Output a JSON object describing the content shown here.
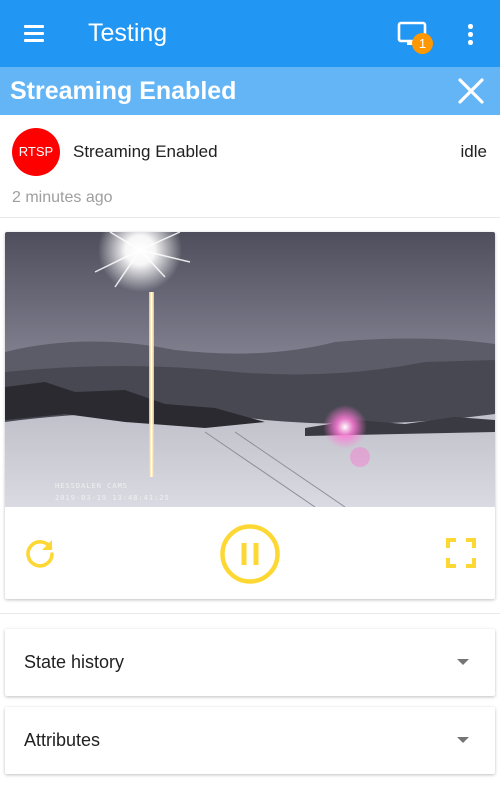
{
  "appbar": {
    "title": "Testing",
    "notification_count": "1",
    "colors": {
      "background": "#2196f3",
      "badge": "#ff9800"
    },
    "icons": {
      "menu": "menu-icon",
      "cast": "cast-icon",
      "more": "more-vert-icon"
    }
  },
  "dialog": {
    "title": "Streaming Enabled",
    "close_icon": "close-icon",
    "header_color": "#64b5f6"
  },
  "entity": {
    "badge": "RTSP",
    "badge_color": "#ff0000",
    "name": "Streaming Enabled",
    "state": "idle",
    "last_changed": "2 minutes ago"
  },
  "camera": {
    "overlay_name": "HESSDALEN CAMS",
    "overlay_timestamp": "2019-03-19 13:48:41:25",
    "controls": {
      "refresh_icon": "refresh-icon",
      "pause_icon": "pause-circle-icon",
      "fullscreen_icon": "fullscreen-icon",
      "accent": "#fdd835"
    }
  },
  "sections": [
    {
      "label": "State history",
      "icon": "chevron-down-icon"
    },
    {
      "label": "Attributes",
      "icon": "chevron-down-icon"
    }
  ]
}
